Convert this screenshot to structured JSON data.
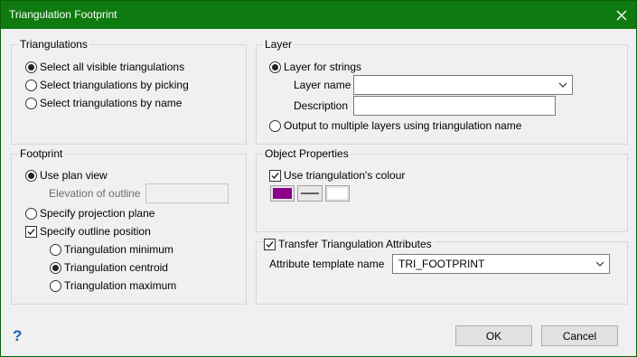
{
  "window": {
    "title": "Triangulation Footprint"
  },
  "triangulations": {
    "legend": "Triangulations",
    "options": [
      "Select all visible triangulations",
      "Select triangulations by picking",
      "Select triangulations by name"
    ],
    "selected": 0
  },
  "layer": {
    "legend": "Layer",
    "layer_for_strings": "Layer for strings",
    "layer_name_label": "Layer name",
    "layer_name_value": "",
    "description_label": "Description",
    "description_value": "",
    "multiple_layers": "Output to multiple layers using triangulation name"
  },
  "footprint": {
    "legend": "Footprint",
    "use_plan_view": "Use plan view",
    "elevation_label": "Elevation of outline",
    "elevation_value": "",
    "projection_plane": "Specify projection plane",
    "outline_position": "Specify outline position",
    "outline_options": [
      "Triangulation minimum",
      "Triangulation centroid",
      "Triangulation maximum"
    ],
    "outline_selected": 1
  },
  "object_properties": {
    "legend": "Object Properties",
    "use_colour": "Use triangulation's colour",
    "colour": "#8b008b"
  },
  "attributes": {
    "transfer_label": "Transfer Triangulation Attributes",
    "template_label": "Attribute template name",
    "template_value": "TRI_FOOTPRINT"
  },
  "buttons": {
    "ok": "OK",
    "cancel": "Cancel",
    "help": "?"
  },
  "colors": {
    "titlebar": "#0f7a0f",
    "help": "#1a5fb4"
  }
}
